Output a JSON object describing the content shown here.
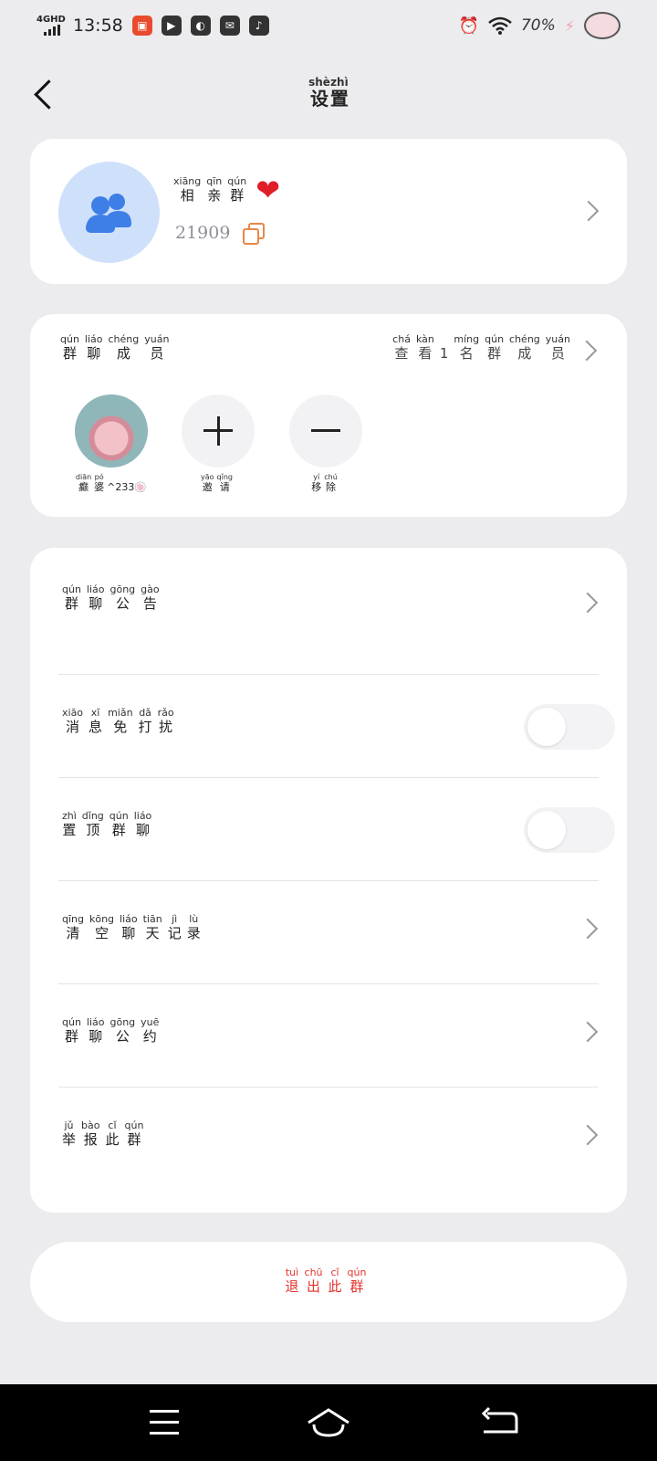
{
  "status_bar": {
    "network": "4GHD",
    "time": "13:58",
    "battery": "70%"
  },
  "header": {
    "title": [
      {
        "han": "设",
        "py": "shè"
      },
      {
        "han": "置",
        "py": "zhì"
      }
    ]
  },
  "group": {
    "name": [
      {
        "han": "相",
        "py": "xiāng"
      },
      {
        "han": "亲",
        "py": "qīn"
      },
      {
        "han": "群",
        "py": "qún"
      }
    ],
    "id": "21909"
  },
  "members": {
    "title": [
      {
        "han": "群",
        "py": "qún"
      },
      {
        "han": "聊",
        "py": "liáo"
      },
      {
        "han": "成",
        "py": "chéng"
      },
      {
        "han": "员",
        "py": "yuán"
      }
    ],
    "view_all": [
      {
        "han": "查",
        "py": "chá"
      },
      {
        "han": "看",
        "py": "kàn"
      },
      {
        "han": "1",
        "py": ""
      },
      {
        "han": "名",
        "py": "míng"
      },
      {
        "han": "群",
        "py": "qún"
      },
      {
        "han": "成",
        "py": "chéng"
      },
      {
        "han": "员",
        "py": "yuán"
      }
    ],
    "list": [
      {
        "name": [
          {
            "han": "癫",
            "py": "diān"
          },
          {
            "han": "婆",
            "py": "pó"
          }
        ],
        "suffix": "^233🍥"
      }
    ],
    "invite": [
      {
        "han": "邀",
        "py": "yāo"
      },
      {
        "han": "请",
        "py": "qǐng"
      }
    ],
    "remove": [
      {
        "han": "移",
        "py": "yí"
      },
      {
        "han": "除",
        "py": "chú"
      }
    ]
  },
  "settings": [
    {
      "id": "announcement",
      "control": "chevron",
      "label": [
        {
          "han": "群",
          "py": "qún"
        },
        {
          "han": "聊",
          "py": "liáo"
        },
        {
          "han": "公",
          "py": "gōng"
        },
        {
          "han": "告",
          "py": "gào"
        }
      ]
    },
    {
      "id": "mute",
      "control": "toggle",
      "on": false,
      "label": [
        {
          "han": "消",
          "py": "xiāo"
        },
        {
          "han": "息",
          "py": "xī"
        },
        {
          "han": "免",
          "py": "miǎn"
        },
        {
          "han": "打",
          "py": "dǎ"
        },
        {
          "han": "扰",
          "py": "rǎo"
        }
      ]
    },
    {
      "id": "pin",
      "control": "toggle",
      "on": false,
      "label": [
        {
          "han": "置",
          "py": "zhì"
        },
        {
          "han": "顶",
          "py": "dǐng"
        },
        {
          "han": "群",
          "py": "qún"
        },
        {
          "han": "聊",
          "py": "liáo"
        }
      ]
    },
    {
      "id": "clear-history",
      "control": "chevron",
      "label": [
        {
          "han": "清",
          "py": "qīng"
        },
        {
          "han": "空",
          "py": "kōng"
        },
        {
          "han": "聊",
          "py": "liáo"
        },
        {
          "han": "天",
          "py": "tiān"
        },
        {
          "han": "记",
          "py": "jì"
        },
        {
          "han": "录",
          "py": "lù"
        }
      ]
    },
    {
      "id": "convention",
      "control": "chevron",
      "label": [
        {
          "han": "群",
          "py": "qún"
        },
        {
          "han": "聊",
          "py": "liáo"
        },
        {
          "han": "公",
          "py": "gōng"
        },
        {
          "han": "约",
          "py": "yuē"
        }
      ]
    },
    {
      "id": "report",
      "control": "chevron",
      "label": [
        {
          "han": "举",
          "py": "jǔ"
        },
        {
          "han": "报",
          "py": "bào"
        },
        {
          "han": "此",
          "py": "cǐ"
        },
        {
          "han": "群",
          "py": "qún"
        }
      ]
    }
  ],
  "exit": [
    {
      "han": "退",
      "py": "tuì"
    },
    {
      "han": "出",
      "py": "chū"
    },
    {
      "han": "此",
      "py": "cǐ"
    },
    {
      "han": "群",
      "py": "qún"
    }
  ],
  "colors": {
    "background": "#ececef",
    "card": "#ffffff",
    "exit_text": "#e4302b",
    "avatar_bg": "#cfe0fb",
    "group_icon": "#3d7fe6",
    "heart": "#e11d2a",
    "copy_icon": "#e6874a"
  }
}
